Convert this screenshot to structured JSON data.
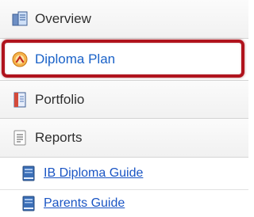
{
  "nav": {
    "items": [
      {
        "label": "Overview",
        "icon": "overview-icon"
      },
      {
        "label": "Diploma Plan",
        "icon": "diploma-plan-icon",
        "active": true
      },
      {
        "label": "Portfolio",
        "icon": "portfolio-icon"
      },
      {
        "label": "Reports",
        "icon": "reports-icon"
      }
    ],
    "sub_items": [
      {
        "label": "IB Diploma Guide",
        "icon": "book-icon"
      },
      {
        "label": "Parents Guide",
        "icon": "book-icon"
      }
    ]
  },
  "colors": {
    "highlight": "#b0131d",
    "link": "#1a55c4",
    "active_text": "#1a62c8"
  }
}
